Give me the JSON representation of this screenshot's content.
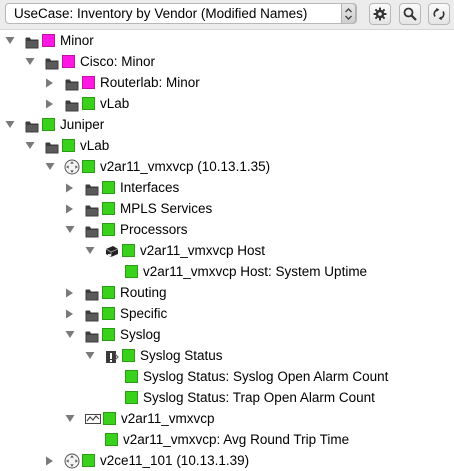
{
  "toolbar": {
    "selector_value": "UseCase: Inventory by Vendor (Modified Names)",
    "buttons": [
      "gear-icon",
      "search-icon",
      "refresh-icon"
    ]
  },
  "colors": {
    "up": "#39d11c",
    "minor": "#ff18e2"
  },
  "tree": [
    {
      "label": "Minor",
      "indent": 0,
      "state": "expanded",
      "icon": "folder",
      "status": "minor"
    },
    {
      "label": "Cisco: Minor",
      "indent": 1,
      "state": "expanded",
      "icon": "folder",
      "status": "minor"
    },
    {
      "label": "Routerlab: Minor",
      "indent": 2,
      "state": "collapsed",
      "icon": "folder",
      "status": "minor"
    },
    {
      "label": "vLab",
      "indent": 2,
      "state": "collapsed",
      "icon": "folder",
      "status": "up"
    },
    {
      "label": "Juniper",
      "indent": 0,
      "state": "expanded",
      "icon": "folder",
      "status": "up"
    },
    {
      "label": "vLab",
      "indent": 1,
      "state": "expanded",
      "icon": "folder",
      "status": "up"
    },
    {
      "label": "v2ar11_vmxvcp (10.13.1.35)",
      "indent": 2,
      "state": "expanded",
      "icon": "device",
      "status": "up"
    },
    {
      "label": "Interfaces",
      "indent": 3,
      "state": "collapsed",
      "icon": "folder",
      "status": "up"
    },
    {
      "label": "MPLS Services",
      "indent": 3,
      "state": "collapsed",
      "icon": "folder",
      "status": "up"
    },
    {
      "label": "Processors",
      "indent": 3,
      "state": "expanded",
      "icon": "folder",
      "status": "up"
    },
    {
      "label": "v2ar11_vmxvcp Host",
      "indent": 4,
      "state": "expanded",
      "icon": "host",
      "status": "up"
    },
    {
      "label": "v2ar11_vmxvcp Host: System Uptime",
      "indent": 5,
      "state": "leaf",
      "icon": "none",
      "status": "up"
    },
    {
      "label": "Routing",
      "indent": 3,
      "state": "collapsed",
      "icon": "folder",
      "status": "up"
    },
    {
      "label": "Specific",
      "indent": 3,
      "state": "collapsed",
      "icon": "folder",
      "status": "up"
    },
    {
      "label": "Syslog",
      "indent": 3,
      "state": "expanded",
      "icon": "folder",
      "status": "up"
    },
    {
      "label": "Syslog Status",
      "indent": 4,
      "state": "expanded",
      "icon": "alert",
      "status": "up"
    },
    {
      "label": "Syslog Status: Syslog Open Alarm Count",
      "indent": 5,
      "state": "leaf",
      "icon": "none",
      "status": "up"
    },
    {
      "label": "Syslog Status: Trap Open Alarm Count",
      "indent": 5,
      "state": "leaf",
      "icon": "none",
      "status": "up"
    },
    {
      "label": "v2ar11_vmxvcp",
      "indent": 3,
      "state": "expanded",
      "icon": "ping",
      "status": "up"
    },
    {
      "label": "v2ar11_vmxvcp: Avg Round Trip Time",
      "indent": 4,
      "state": "leaf",
      "icon": "none",
      "status": "up"
    },
    {
      "label": "v2ce11_101 (10.13.1.39)",
      "indent": 2,
      "state": "collapsed",
      "icon": "device",
      "status": "up"
    }
  ]
}
